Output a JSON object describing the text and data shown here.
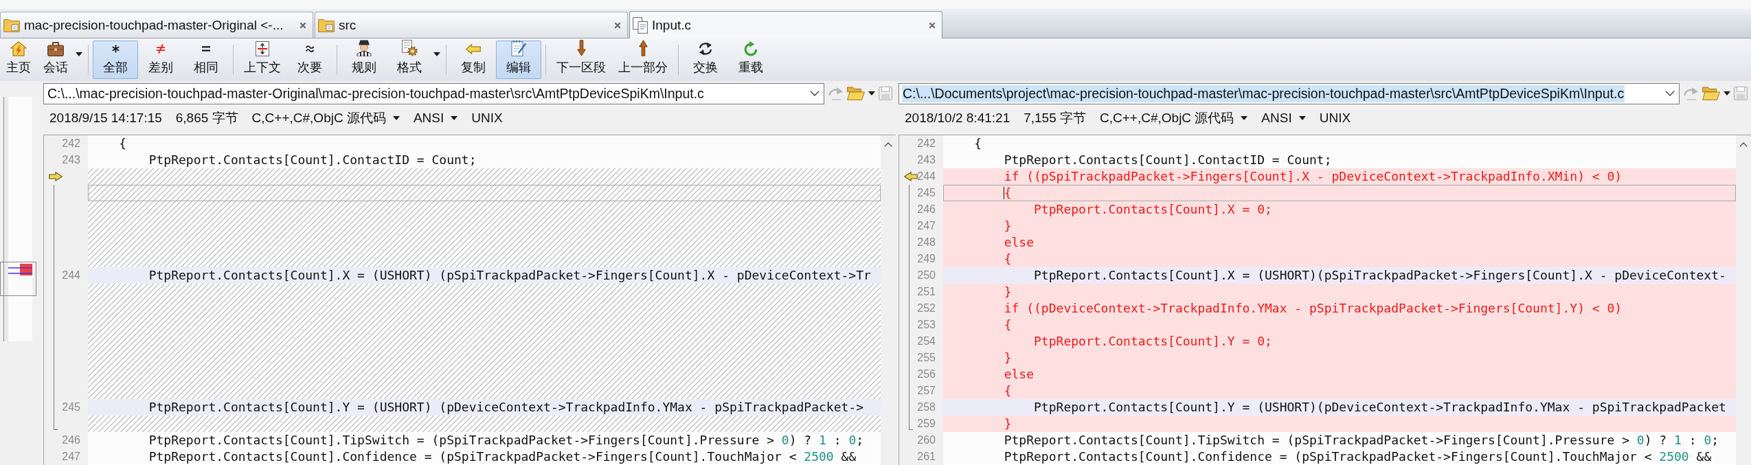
{
  "tabs": [
    {
      "kind": "folder",
      "label": "mac-precision-touchpad-master-Original <-...",
      "selected": false
    },
    {
      "kind": "folder",
      "label": "src",
      "selected": false
    },
    {
      "kind": "file",
      "label": "Input.c",
      "selected": true
    }
  ],
  "toolbar": {
    "groups": [
      [
        {
          "label": "主页",
          "selected": false,
          "dropdown": false
        },
        {
          "label": "会话",
          "selected": false,
          "dropdown": true
        }
      ],
      [
        {
          "label": "全部",
          "selected": true,
          "dropdown": false
        },
        {
          "label": "差别",
          "selected": false,
          "dropdown": false
        },
        {
          "label": "相同",
          "selected": false,
          "dropdown": false
        }
      ],
      [
        {
          "label": "上下文",
          "selected": false,
          "dropdown": false
        },
        {
          "label": "次要",
          "selected": false,
          "dropdown": false
        }
      ],
      [
        {
          "label": "规则",
          "selected": false,
          "dropdown": false
        },
        {
          "label": "格式",
          "selected": false,
          "dropdown": true
        }
      ],
      [
        {
          "label": "复制",
          "selected": false,
          "dropdown": false
        },
        {
          "label": "编辑",
          "selected": true,
          "dropdown": false
        }
      ],
      [
        {
          "label": "下一区段",
          "selected": false,
          "dropdown": false
        },
        {
          "label": "上一部分",
          "selected": false,
          "dropdown": false
        }
      ],
      [
        {
          "label": "交换",
          "selected": false,
          "dropdown": false
        },
        {
          "label": "重载",
          "selected": false,
          "dropdown": false
        }
      ]
    ]
  },
  "panes": [
    {
      "path": "C:\\...\\mac-precision-touchpad-master-Original\\mac-precision-touchpad-master\\src\\AmtPtpDeviceSpiKm\\Input.c",
      "path_highlighted": false,
      "buttons": [
        {
          "disabled": true,
          "dropdown": false
        },
        {
          "disabled": false,
          "dropdown": true
        },
        {
          "disabled": true,
          "dropdown": false
        }
      ],
      "modified": "2018/9/15 14:17:15",
      "size": "6,865 字节",
      "language": "C,C++,C#,ObjC 源代码",
      "encoding": "ANSI",
      "line_ending": "UNIX",
      "focused": false,
      "lines": [
        {
          "kind": "same",
          "number": "242",
          "text": "    {",
          "marked": false,
          "current": false
        },
        {
          "kind": "same",
          "number": "243",
          "text": "        PtpReport.Contacts[Count].ContactID = Count;",
          "marked": false,
          "current": false
        },
        {
          "kind": "blank",
          "marked": true,
          "current": false
        },
        {
          "kind": "blank",
          "marked": false,
          "current": true
        },
        {
          "kind": "blank",
          "marked": false,
          "current": false
        },
        {
          "kind": "blank",
          "marked": false,
          "current": false
        },
        {
          "kind": "blank",
          "marked": false,
          "current": false
        },
        {
          "kind": "blank",
          "marked": false,
          "current": false
        },
        {
          "kind": "changed",
          "number": "244",
          "text": "        PtpReport.Contacts[Count].X = (USHORT) (pSpiTrackpadPacket->Fingers[Count].X - pDeviceContext->Tr",
          "marked": false,
          "current": false
        },
        {
          "kind": "blank",
          "marked": false,
          "current": false
        },
        {
          "kind": "blank",
          "marked": false,
          "current": false
        },
        {
          "kind": "blank",
          "marked": false,
          "current": false
        },
        {
          "kind": "blank",
          "marked": false,
          "current": false
        },
        {
          "kind": "blank",
          "marked": false,
          "current": false
        },
        {
          "kind": "blank",
          "marked": false,
          "current": false
        },
        {
          "kind": "blank",
          "marked": false,
          "current": false
        },
        {
          "kind": "changed",
          "number": "245",
          "text": "        PtpReport.Contacts[Count].Y = (USHORT) (pDeviceContext->TrackpadInfo.YMax - pSpiTrackpadPacket->",
          "marked": false,
          "current": false
        },
        {
          "kind": "blank",
          "marked": false,
          "current": false
        },
        {
          "kind": "same",
          "number": "246",
          "text": "        PtpReport.Contacts[Count].TipSwitch = (pSpiTrackpadPacket->Fingers[Count].Pressure > 0) ? 1 : 0;",
          "marked": false,
          "current": false
        },
        {
          "kind": "same",
          "number": "247",
          "text": "        PtpReport.Contacts[Count].Confidence = (pSpiTrackpadPacket->Fingers[Count].TouchMajor < 2500 &&",
          "marked": false,
          "current": false
        }
      ]
    },
    {
      "path": "C:\\...\\Documents\\project\\mac-precision-touchpad-master\\mac-precision-touchpad-master\\src\\AmtPtpDeviceSpiKm\\Input.c",
      "path_highlighted": true,
      "buttons": [
        {
          "disabled": true,
          "dropdown": false
        },
        {
          "disabled": false,
          "dropdown": true
        },
        {
          "disabled": true,
          "dropdown": false
        }
      ],
      "modified": "2018/10/2 8:41:21",
      "size": "7,155 字节",
      "language": "C,C++,C#,ObjC 源代码",
      "encoding": "ANSI",
      "line_ending": "UNIX",
      "focused": true,
      "lines": [
        {
          "kind": "same",
          "number": "242",
          "text": "    {",
          "marked": false,
          "current": false
        },
        {
          "kind": "same",
          "number": "243",
          "text": "        PtpReport.Contacts[Count].ContactID = Count;",
          "marked": false,
          "current": false
        },
        {
          "kind": "added",
          "number": "244",
          "text": "        if ((pSpiTrackpadPacket->Fingers[Count].X - pDeviceContext->TrackpadInfo.XMin) < 0)",
          "marked": true,
          "current": false
        },
        {
          "kind": "added",
          "number": "245",
          "text": "        {",
          "marked": false,
          "current": true
        },
        {
          "kind": "added",
          "number": "246",
          "text": "            PtpReport.Contacts[Count].X = 0;",
          "marked": false,
          "current": false
        },
        {
          "kind": "added",
          "number": "247",
          "text": "        }",
          "marked": false,
          "current": false
        },
        {
          "kind": "added",
          "number": "248",
          "text": "        else",
          "marked": false,
          "current": false
        },
        {
          "kind": "added",
          "number": "249",
          "text": "        {",
          "marked": false,
          "current": false
        },
        {
          "kind": "changed",
          "number": "250",
          "text": "            PtpReport.Contacts[Count].X = (USHORT)(pSpiTrackpadPacket->Fingers[Count].X - pDeviceContext-",
          "marked": false,
          "current": false
        },
        {
          "kind": "added",
          "number": "251",
          "text": "        }",
          "marked": false,
          "current": false
        },
        {
          "kind": "added",
          "number": "252",
          "text": "        if ((pDeviceContext->TrackpadInfo.YMax - pSpiTrackpadPacket->Fingers[Count].Y) < 0)",
          "marked": false,
          "current": false
        },
        {
          "kind": "added",
          "number": "253",
          "text": "        {",
          "marked": false,
          "current": false
        },
        {
          "kind": "added",
          "number": "254",
          "text": "            PtpReport.Contacts[Count].Y = 0;",
          "marked": false,
          "current": false
        },
        {
          "kind": "added",
          "number": "255",
          "text": "        }",
          "marked": false,
          "current": false
        },
        {
          "kind": "added",
          "number": "256",
          "text": "        else",
          "marked": false,
          "current": false
        },
        {
          "kind": "added",
          "number": "257",
          "text": "        {",
          "marked": false,
          "current": false
        },
        {
          "kind": "changed",
          "number": "258",
          "text": "            PtpReport.Contacts[Count].Y = (USHORT)(pDeviceContext->TrackpadInfo.YMax - pSpiTrackpadPacket",
          "marked": false,
          "current": false
        },
        {
          "kind": "added",
          "number": "259",
          "text": "        }",
          "marked": false,
          "current": false
        },
        {
          "kind": "same",
          "number": "260",
          "text": "        PtpReport.Contacts[Count].TipSwitch = (pSpiTrackpadPacket->Fingers[Count].Pressure > 0) ? 1 : 0;",
          "marked": false,
          "current": false
        },
        {
          "kind": "same",
          "number": "261",
          "text": "        PtpReport.Contacts[Count].Confidence = (pSpiTrackpadPacket->Fingers[Count].TouchMajor < 2500 &&",
          "marked": false,
          "current": false
        }
      ]
    }
  ]
}
